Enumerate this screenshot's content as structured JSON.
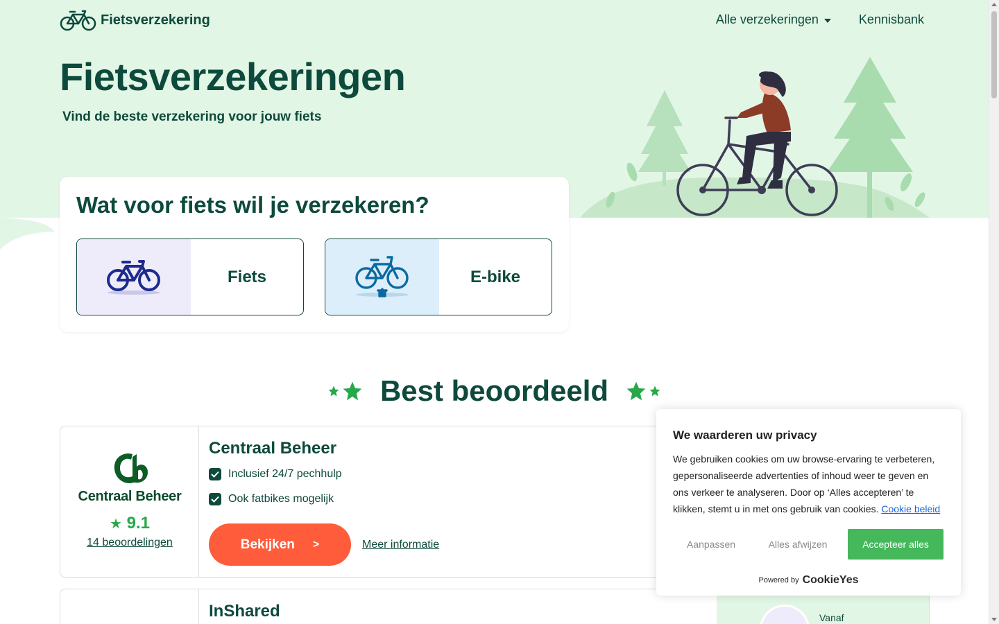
{
  "header": {
    "logo_text": "Fietsverzekering",
    "nav": [
      {
        "label": "Alle verzekeringen",
        "has_dropdown": true
      },
      {
        "label": "Kennisbank",
        "has_dropdown": false
      }
    ]
  },
  "hero": {
    "title": "Fietsverzekeringen",
    "subtitle": "Vind de beste verzekering voor jouw fiets"
  },
  "choice": {
    "title": "Wat voor fiets wil je verzekeren?",
    "options": [
      {
        "label": "Fiets",
        "icon": "bicycle-icon",
        "bg": "#eeecfb",
        "icon_color": "#1c2b8c"
      },
      {
        "label": "E-bike",
        "icon": "e-bike-icon",
        "bg": "#dceefa",
        "icon_color": "#0b6aa0"
      }
    ]
  },
  "best_rated": {
    "title": "Best beoordeeld"
  },
  "insurers": [
    {
      "name": "Centraal Beheer",
      "logo_text": "Centraal Beheer",
      "rating": "9.1",
      "reviews": "14 beoordelingen",
      "features": [
        "Inclusief 24/7 pechhulp",
        "Ook fatbikes mogelijk"
      ],
      "view_label": "Bekijken",
      "view_arrow": ">",
      "more_label": "Meer informatie"
    },
    {
      "name": "InShared",
      "price_prefix": "Vanaf"
    }
  ],
  "cookie": {
    "title": "We waarderen uw privacy",
    "text": "We gebruiken cookies om uw browse-ervaring te verbeteren, gepersonaliseerde advertenties of inhoud weer te geven en ons verkeer te analyseren. Door op ‘Alles accepteren’ te klikken, stemt u in met ons gebruik van cookies.",
    "policy_link": "Cookie beleid",
    "customize": "Aanpassen",
    "reject": "Alles afwijzen",
    "accept": "Accepteer alles",
    "powered_by": "Powered by",
    "brand": "CookieYes"
  },
  "colors": {
    "primary": "#0d4a3c",
    "hero_bg": "#e2f6e6",
    "accent_green": "#27a84a",
    "cta_orange": "#ff5c3b",
    "cookie_accept": "#44b85b"
  }
}
